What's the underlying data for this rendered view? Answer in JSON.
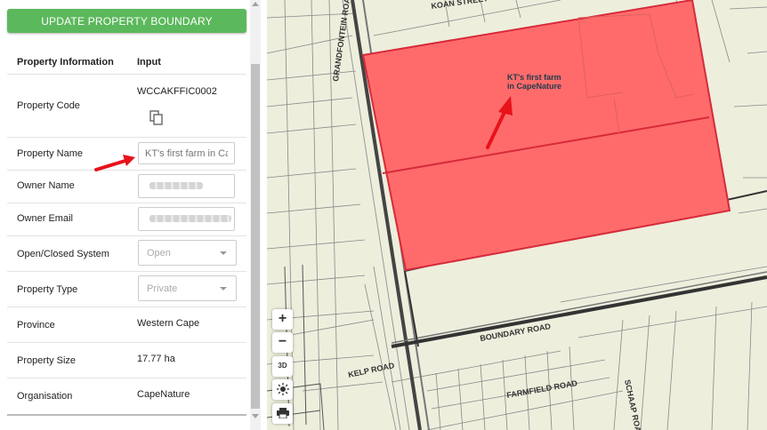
{
  "panel": {
    "update_button": "UPDATE PROPERTY BOUNDARY",
    "header": {
      "col1": "Property Information",
      "col2": "Input"
    },
    "rows": {
      "code": {
        "label": "Property Code",
        "value": "WCCAKFFIC0002"
      },
      "name": {
        "label": "Property Name",
        "placeholder": "KT's first farm in CapeNature"
      },
      "owner_name": {
        "label": "Owner Name"
      },
      "owner_email": {
        "label": "Owner Email"
      },
      "system": {
        "label": "Open/Closed System",
        "value": "Open"
      },
      "type": {
        "label": "Property Type",
        "value": "Private"
      },
      "province": {
        "label": "Province",
        "value": "Western Cape"
      },
      "size": {
        "label": "Property Size",
        "value": "17.77 ha"
      },
      "organisation": {
        "label": "Organisation",
        "value": "CapeNature"
      }
    }
  },
  "map": {
    "farm_label_line1": "KT's first farm",
    "farm_label_line2": "in CapeNature",
    "roads": {
      "koan": "KOAN STREET",
      "grandfontein": "GRANDFONTEIN ROAD",
      "boundary": "BOUNDARY ROAD",
      "kelp": "KELP ROAD",
      "farmfield": "FARMFIELD ROAD",
      "schaap": "SCHAAP ROAD"
    },
    "controls": {
      "zoom_in": "+",
      "zoom_out": "−",
      "three_d": "3D"
    },
    "colors": {
      "property_fill": "#ff6b6b",
      "property_stroke": "#d62b3a",
      "arrow": "#e8121a",
      "background": "#eeeedd"
    }
  }
}
